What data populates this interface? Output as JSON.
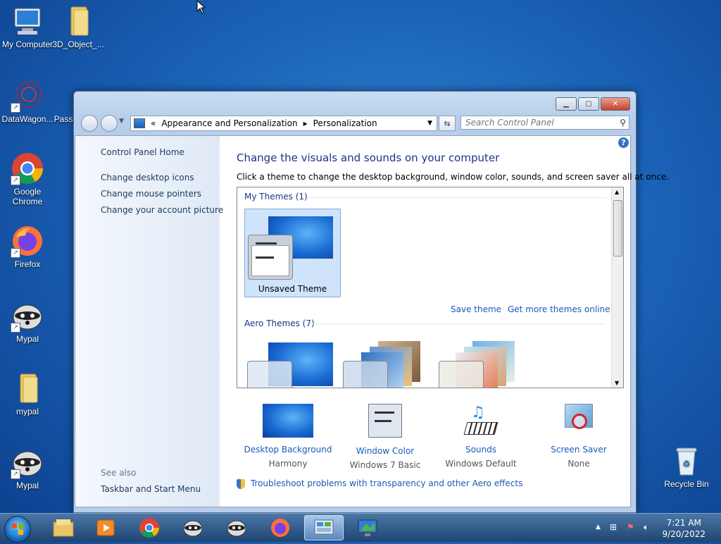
{
  "desktop": {
    "icons": [
      {
        "label": "My Computer",
        "icon": "computer-icon"
      },
      {
        "label": "3D_Object_...",
        "icon": "folder-icon"
      },
      {
        "label": "DataWagon...",
        "icon": "datawagon-icon"
      },
      {
        "label": "Pass",
        "icon": "file-icon"
      },
      {
        "label": "Google Chrome",
        "icon": "chrome-icon"
      },
      {
        "label": "Firefox",
        "icon": "firefox-icon"
      },
      {
        "label": "Mypal",
        "icon": "raccoon-icon"
      },
      {
        "label": "mypal",
        "icon": "folder-icon"
      },
      {
        "label": "Mypal",
        "icon": "raccoon-icon"
      },
      {
        "label": "Recycle Bin",
        "icon": "recycle-bin-icon"
      }
    ]
  },
  "window": {
    "address": {
      "prefix": "«",
      "crumb1": "Appearance and Personalization",
      "crumb2": "Personalization"
    },
    "search_placeholder": "Search Control Panel",
    "left": {
      "home": "Control Panel Home",
      "links": [
        "Change desktop icons",
        "Change mouse pointers",
        "Change your account picture"
      ],
      "see_also": "See also",
      "see_also_link": "Taskbar and Start Menu"
    },
    "main": {
      "title": "Change the visuals and sounds on your computer",
      "subtitle": "Click a theme to change the desktop background, window color, sounds, and screen saver all at once.",
      "my_themes": "My Themes (1)",
      "unsaved_theme": "Unsaved Theme",
      "save_theme": "Save theme",
      "get_more": "Get more themes online",
      "aero_themes": "Aero Themes (7)",
      "bottom": [
        {
          "label": "Desktop Background",
          "value": "Harmony"
        },
        {
          "label": "Window Color",
          "value": "Windows 7 Basic"
        },
        {
          "label": "Sounds",
          "value": "Windows Default"
        },
        {
          "label": "Screen Saver",
          "value": "None"
        }
      ],
      "troubleshoot": "Troubleshoot problems with transparency and other Aero effects"
    }
  },
  "taskbar": {
    "time": "7:21 AM",
    "date": "9/20/2022"
  }
}
